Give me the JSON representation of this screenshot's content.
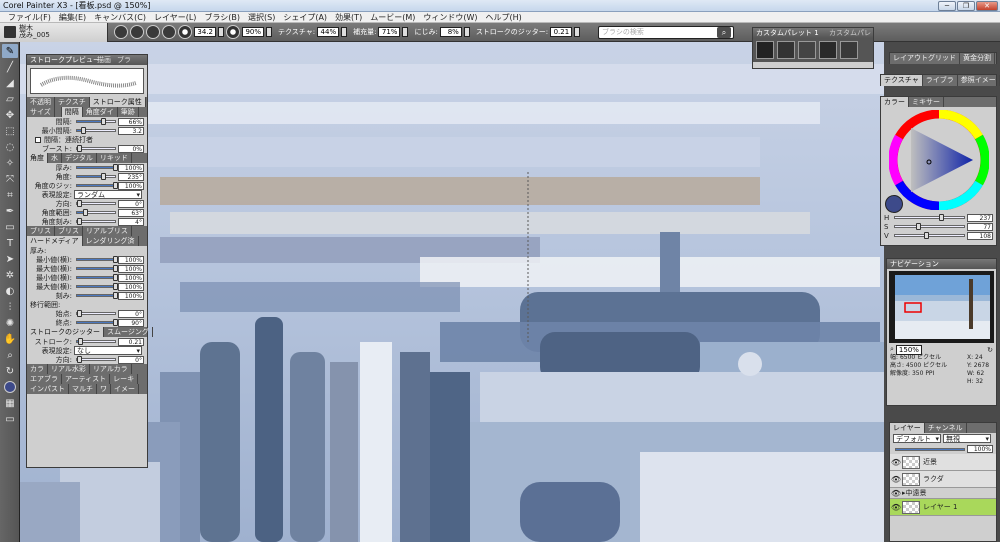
{
  "window": {
    "title": "Corel Painter X3 - [看板.psd @ 150%]",
    "controls": [
      "─",
      "❐",
      "✕"
    ]
  },
  "menu": [
    "ファイル(F)",
    "編集(E)",
    "キャンバス(C)",
    "レイヤー(L)",
    "ブラシ(B)",
    "選択(S)",
    "シェイプ(A)",
    "効果(T)",
    "ムービー(M)",
    "ウィンドウ(W)",
    "ヘルプ(H)"
  ],
  "brush_selector": {
    "category": "樹木",
    "variant": "茂み_005"
  },
  "property_bar": {
    "size": "34.2",
    "opacity": "90%",
    "texture_label": "テクスチャ:",
    "texture": "44%",
    "resaturation_label": "補充量:",
    "resaturation": "71%",
    "bleed_label": "にじみ:",
    "bleed": "8%",
    "jitter_label": "ストロークのジッター:",
    "jitter": "0.21"
  },
  "search": {
    "placeholder": "ブラシの検索"
  },
  "custom_palette": {
    "title": "カスタムパレット 1",
    "tab2": "カスタムパレ"
  },
  "right_tabs": {
    "layout_grid": "レイアウトグリッド",
    "golden": "黄金分割",
    "texture": "テクスチャ",
    "library": "ライブラ",
    "reference": "参照イメー"
  },
  "color_panel": {
    "tab_color": "カラー",
    "tab_mixer": "ミキサー",
    "H_label": "H",
    "H": "237",
    "S_label": "S",
    "S": "77",
    "V_label": "V",
    "V": "108",
    "main_color": "#3d4a8a",
    "sub_color": "#6b8cc4"
  },
  "navigator": {
    "title": "ナビゲーション",
    "zoom": "150%",
    "width_label": "幅:",
    "width_value": "6500 ピクセル",
    "height_label": "高さ:",
    "height_value": "4500 ピクセル",
    "res_label": "解像度:",
    "res_value": "350 PPI",
    "x": "X: 24",
    "y": "Y: 2678",
    "w": "W: 62",
    "h": "H: 32"
  },
  "layers": {
    "tab_layers": "レイヤー",
    "tab_channels": "チャンネル",
    "composite_method": "デフォルト",
    "preserve": "無視",
    "opacity": "100%",
    "items": [
      {
        "name": "近景",
        "type": "layer"
      },
      {
        "name": "ラクダ",
        "type": "layer"
      },
      {
        "name": "中遠景",
        "type": "group"
      },
      {
        "name": "レイヤー 1",
        "type": "layer",
        "selected": true
      }
    ]
  },
  "brush_controls": {
    "preview_title": "ストロークプレビュー",
    "preview_tabs": [
      "描画",
      "ブラ"
    ],
    "tabs_row1": [
      "不透明",
      "テクスチ",
      "ストローク属性"
    ],
    "tabs_row2": [
      "サイズ",
      "",
      "間隔",
      "角度ダイ",
      "筆跡"
    ],
    "spacing_label": "間隔:",
    "spacing": "66%",
    "min_spacing_label": "最小間隔:",
    "min_spacing": "3.2",
    "continuous_label": "間隔：連続打者",
    "boost_label": "ブースト:",
    "boost": "0%",
    "angle_section": "角度",
    "angle_tabs": [
      "水",
      "デジタル",
      "リキッド"
    ],
    "squeeze_label": "厚み:",
    "squeeze": "100%",
    "angle_label": "角度:",
    "angle": "235°",
    "angle_jitter_label": "角度のジッ:",
    "angle_jitter": "100%",
    "expression_label": "表現設定:",
    "expression": "ランダム",
    "direction_label": "方向:",
    "direction": "0°",
    "angle_range_label": "角度範囲:",
    "angle_range": "63°",
    "angle_step_label": "角度刻み:",
    "angle_step": "4°",
    "tabs_row3": [
      "ブリス",
      "ブリス",
      "リアルブリス"
    ],
    "hard_media_tabs": [
      "ハードメディア",
      "レンダリング済"
    ],
    "thickness_label": "厚み:",
    "min_thick_label": "最小値(横):",
    "min_thick": "100%",
    "max_thick_label": "最大値(横):",
    "max_thick": "100%",
    "min_thick2_label": "最小値(横):",
    "min_thick2": "100%",
    "max_thick2_label": "最大値(横):",
    "max_thick2": "100%",
    "squeeze2_label": "刻み:",
    "squeeze2": "100%",
    "transition_label": "移行範囲:",
    "start_label": "始点:",
    "start": "0°",
    "end_label": "終点:",
    "end": "90°",
    "jitter_section": "ストロークのジッター",
    "smoothing_tab": "スムージング",
    "stroke_jitter_label": "ストローク:",
    "stroke_jitter": "0.21",
    "expr2_label": "表現設定:",
    "expr2": "なし",
    "dir2_label": "方向:",
    "dir2": "0°",
    "bottom_tabs1": [
      "カラ",
      "リアル水彩",
      "リアルカラ"
    ],
    "bottom_tabs2": [
      "エアブラ",
      "アーティスト",
      "レーキ"
    ],
    "bottom_tabs3": [
      "インパスト",
      "マルチ",
      "ワ",
      "イメー"
    ]
  }
}
